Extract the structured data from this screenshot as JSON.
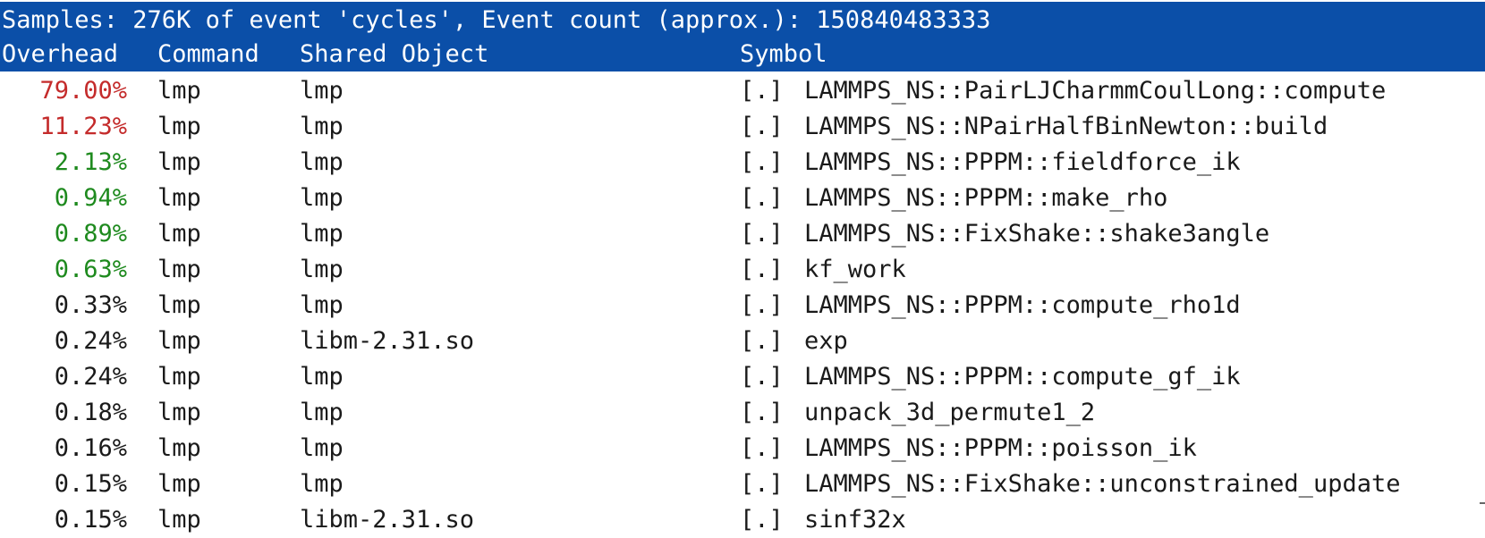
{
  "header": {
    "summary": "Samples: 276K of event 'cycles', Event count (approx.): 150840483333",
    "columns": {
      "overhead": "Overhead",
      "command": "Command",
      "shared_object": "Shared Object",
      "symbol": "Symbol"
    },
    "background_color": "#0b4fa8"
  },
  "rows": [
    {
      "overhead": "79.00%",
      "command": "lmp",
      "shared_object": "lmp",
      "level": "[.]",
      "symbol": "LAMMPS_NS::PairLJCharmmCoulLong::compute",
      "heat": "hot"
    },
    {
      "overhead": "11.23%",
      "command": "lmp",
      "shared_object": "lmp",
      "level": "[.]",
      "symbol": "LAMMPS_NS::NPairHalfBinNewton::build",
      "heat": "hot"
    },
    {
      "overhead": "2.13%",
      "command": "lmp",
      "shared_object": "lmp",
      "level": "[.]",
      "symbol": "LAMMPS_NS::PPPM::fieldforce_ik",
      "heat": "warm"
    },
    {
      "overhead": "0.94%",
      "command": "lmp",
      "shared_object": "lmp",
      "level": "[.]",
      "symbol": "LAMMPS_NS::PPPM::make_rho",
      "heat": "warm"
    },
    {
      "overhead": "0.89%",
      "command": "lmp",
      "shared_object": "lmp",
      "level": "[.]",
      "symbol": "LAMMPS_NS::FixShake::shake3angle",
      "heat": "warm"
    },
    {
      "overhead": "0.63%",
      "command": "lmp",
      "shared_object": "lmp",
      "level": "[.]",
      "symbol": "kf_work",
      "heat": "warm"
    },
    {
      "overhead": "0.33%",
      "command": "lmp",
      "shared_object": "lmp",
      "level": "[.]",
      "symbol": "LAMMPS_NS::PPPM::compute_rho1d",
      "heat": "cold"
    },
    {
      "overhead": "0.24%",
      "command": "lmp",
      "shared_object": "libm-2.31.so",
      "level": "[.]",
      "symbol": "exp",
      "heat": "cold"
    },
    {
      "overhead": "0.24%",
      "command": "lmp",
      "shared_object": "lmp",
      "level": "[.]",
      "symbol": "LAMMPS_NS::PPPM::compute_gf_ik",
      "heat": "cold"
    },
    {
      "overhead": "0.18%",
      "command": "lmp",
      "shared_object": "lmp",
      "level": "[.]",
      "symbol": "unpack_3d_permute1_2",
      "heat": "cold"
    },
    {
      "overhead": "0.16%",
      "command": "lmp",
      "shared_object": "lmp",
      "level": "[.]",
      "symbol": "LAMMPS_NS::PPPM::poisson_ik",
      "heat": "cold"
    },
    {
      "overhead": "0.15%",
      "command": "lmp",
      "shared_object": "lmp",
      "level": "[.]",
      "symbol": "LAMMPS_NS::FixShake::unconstrained_update",
      "heat": "cold"
    },
    {
      "overhead": "0.15%",
      "command": "lmp",
      "shared_object": "libm-2.31.so",
      "level": "[.]",
      "symbol": "sinf32x",
      "heat": "cold"
    }
  ],
  "colors": {
    "hot": "#c42b2b",
    "warm": "#1e8a1e",
    "cold": "#1a1a1a"
  }
}
